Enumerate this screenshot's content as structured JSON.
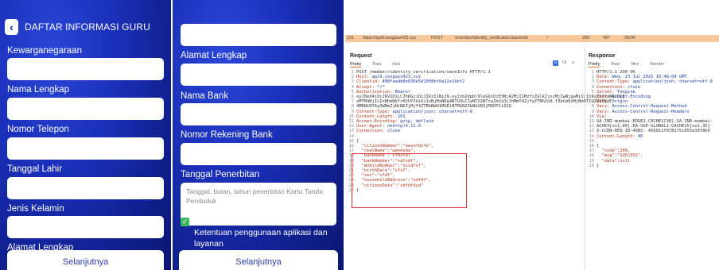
{
  "left_phone": {
    "title": "DAFTAR INFORMASI GURU",
    "fields": [
      "Kewarganegaraan",
      "Nama Lengkap",
      "Nomor Telepon",
      "Tanggal Lahir",
      "Jenis Kelamin",
      "Alamat Lengkap"
    ],
    "next_label": "Selanjutnya"
  },
  "right_phone": {
    "fields": [
      "Alamat Lengkap",
      "Nama Bank",
      "Nomor Rekening Bank",
      "Tanggal Penerbitan"
    ],
    "textarea_placeholder": "Tanggal, bulan, tahun penerbitan Kartu Tanda Penduduk",
    "agree_text": "Saya setuju dengan Syarat dan Ketentuan penggunaan aplikasi dan layanan",
    "next_label": "Selanjutnya"
  },
  "proxy": {
    "history_row": {
      "id": "131",
      "host": "https://api9.sxxgaxx423.xyz",
      "method": "POST",
      "url": "/member/identity_verification/saveInfo",
      "edited": "✓",
      "status": "200",
      "length": "497",
      "mime": "JSON"
    },
    "request": {
      "label": "Request",
      "tabs": [
        "Pretty",
        "Raw",
        "Hex"
      ],
      "lines": [
        "POST /member/identity_verification/saveInfo HTTP/1.1",
        "Host: api9.sxxgaxx423.xyz",
        "Clientid: 408feedd8e836e5d1008bf8a12e1bbf2",
        "Accept: */*",
        "Authorization: Bearer",
        "eyJ0eXAiOiJKV1QiLCJhbGciOiJIUzI1NiJ9.eyJzb2dpbl9leGQiOjE3NjA2MjI1MzYsZGlkIjoiMjIwNjgwMiIsInVzZXJfaWQiOjI",
        "xMTM4NjIsInNhbWVfcHJhY2UiOiIxNjMxNDg4NTU3LCIyNTU2NTcwZnUiOiJhMmY4ZjYyYTNhIn0.f3bCmQxMjBmNTIwZmY5NzE",
        "4MDNiNTAyOWRmZjNiNDZjMjY4ZTBhNWU1MGRlNTM1N2ZkNGU0ZjM3OTViZ2Q",
        "Content-Type: application/json; charset=utf-8",
        "Content-Length: 201",
        "Accept-Encoding: gzip, deflate",
        "User-Agent: okhttp/4.12.0",
        "Connection: close",
        "",
        "{",
        "  \"citizenNumber\":\"aevefdsfe\",",
        "  \"realName\":\"wendsda\",",
        "  \"bankName\":\"sfdsfdf\",",
        "  \"bankNumber\":\"sdfsdf\",",
        "  \"mobileNumber\":\"sssafsf\",",
        "  \"birthDate\":\"sfsf\",",
        "  \"sex\":\"sfdf\",",
        "  \"householdAddress\":\"sdfdf\",",
        "  \"citizenDate\":\"sdfdfdsd\"",
        "}"
      ]
    },
    "response": {
      "label": "Response",
      "tabs": [
        "Pretty",
        "Raw",
        "Hex",
        "Render"
      ],
      "lines": [
        "HTTP/1.1 200 OK",
        "Date: Wed, 23 Jul 2025 10:48:04 GMT",
        "Content-Type: application/json; charset=utf-8",
        "Connection: close",
        "Server: Tengine",
        "Vary: Accept-Encoding",
        "Vary: Origin",
        "Vary: Access-Control-Request-Method",
        "Vary: Access-Control-Request-Headers",
        "Via:",
        "SA-IND-mumbai-EDGE2-CACHE1[90],SA-IND-mumbai-",
        "ACHE4[ov1,40],EA-SGP-GLOBAL1-CACHE25[ov1,35]",
        "X-CCDN-REQ-ID-46B1: 456011f0782f5c855d10f8b9",
        "Content-Length: 40",
        "",
        "{",
        "  \"code\":200,",
        "  \"msg\":\"SUCCESS\",",
        "  \"data\":null",
        "}"
      ]
    }
  }
}
